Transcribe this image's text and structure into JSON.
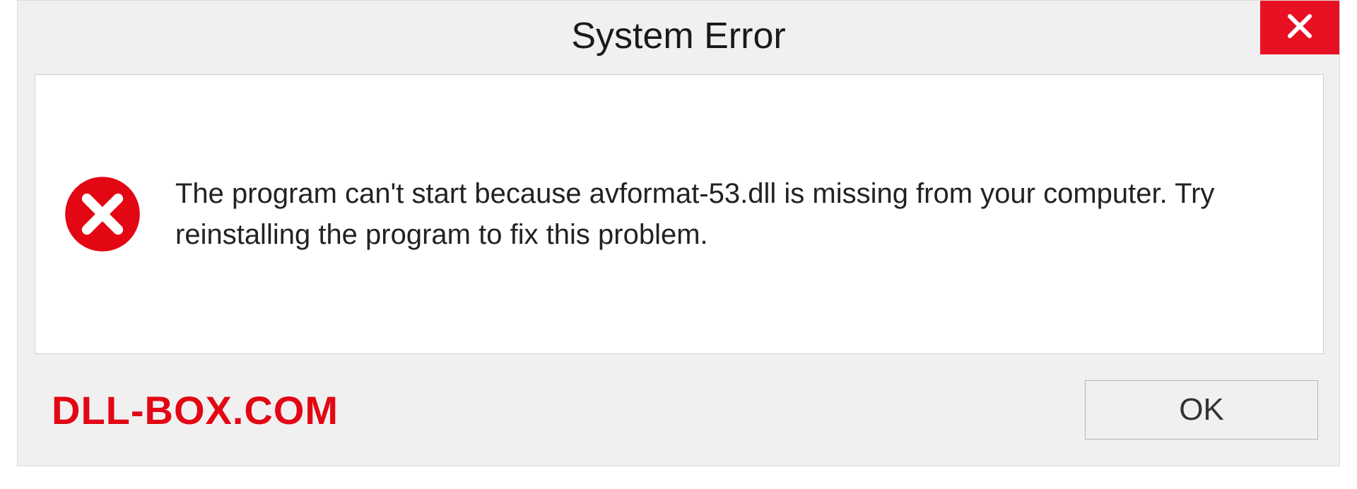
{
  "dialog": {
    "title": "System Error",
    "message": "The program can't start because avformat-53.dll is missing from your computer. Try reinstalling the program to fix this problem.",
    "ok_label": "OK"
  },
  "watermark": "DLL-BOX.COM",
  "colors": {
    "close_bg": "#e81123",
    "error_icon": "#e30613",
    "watermark": "#e30613"
  }
}
